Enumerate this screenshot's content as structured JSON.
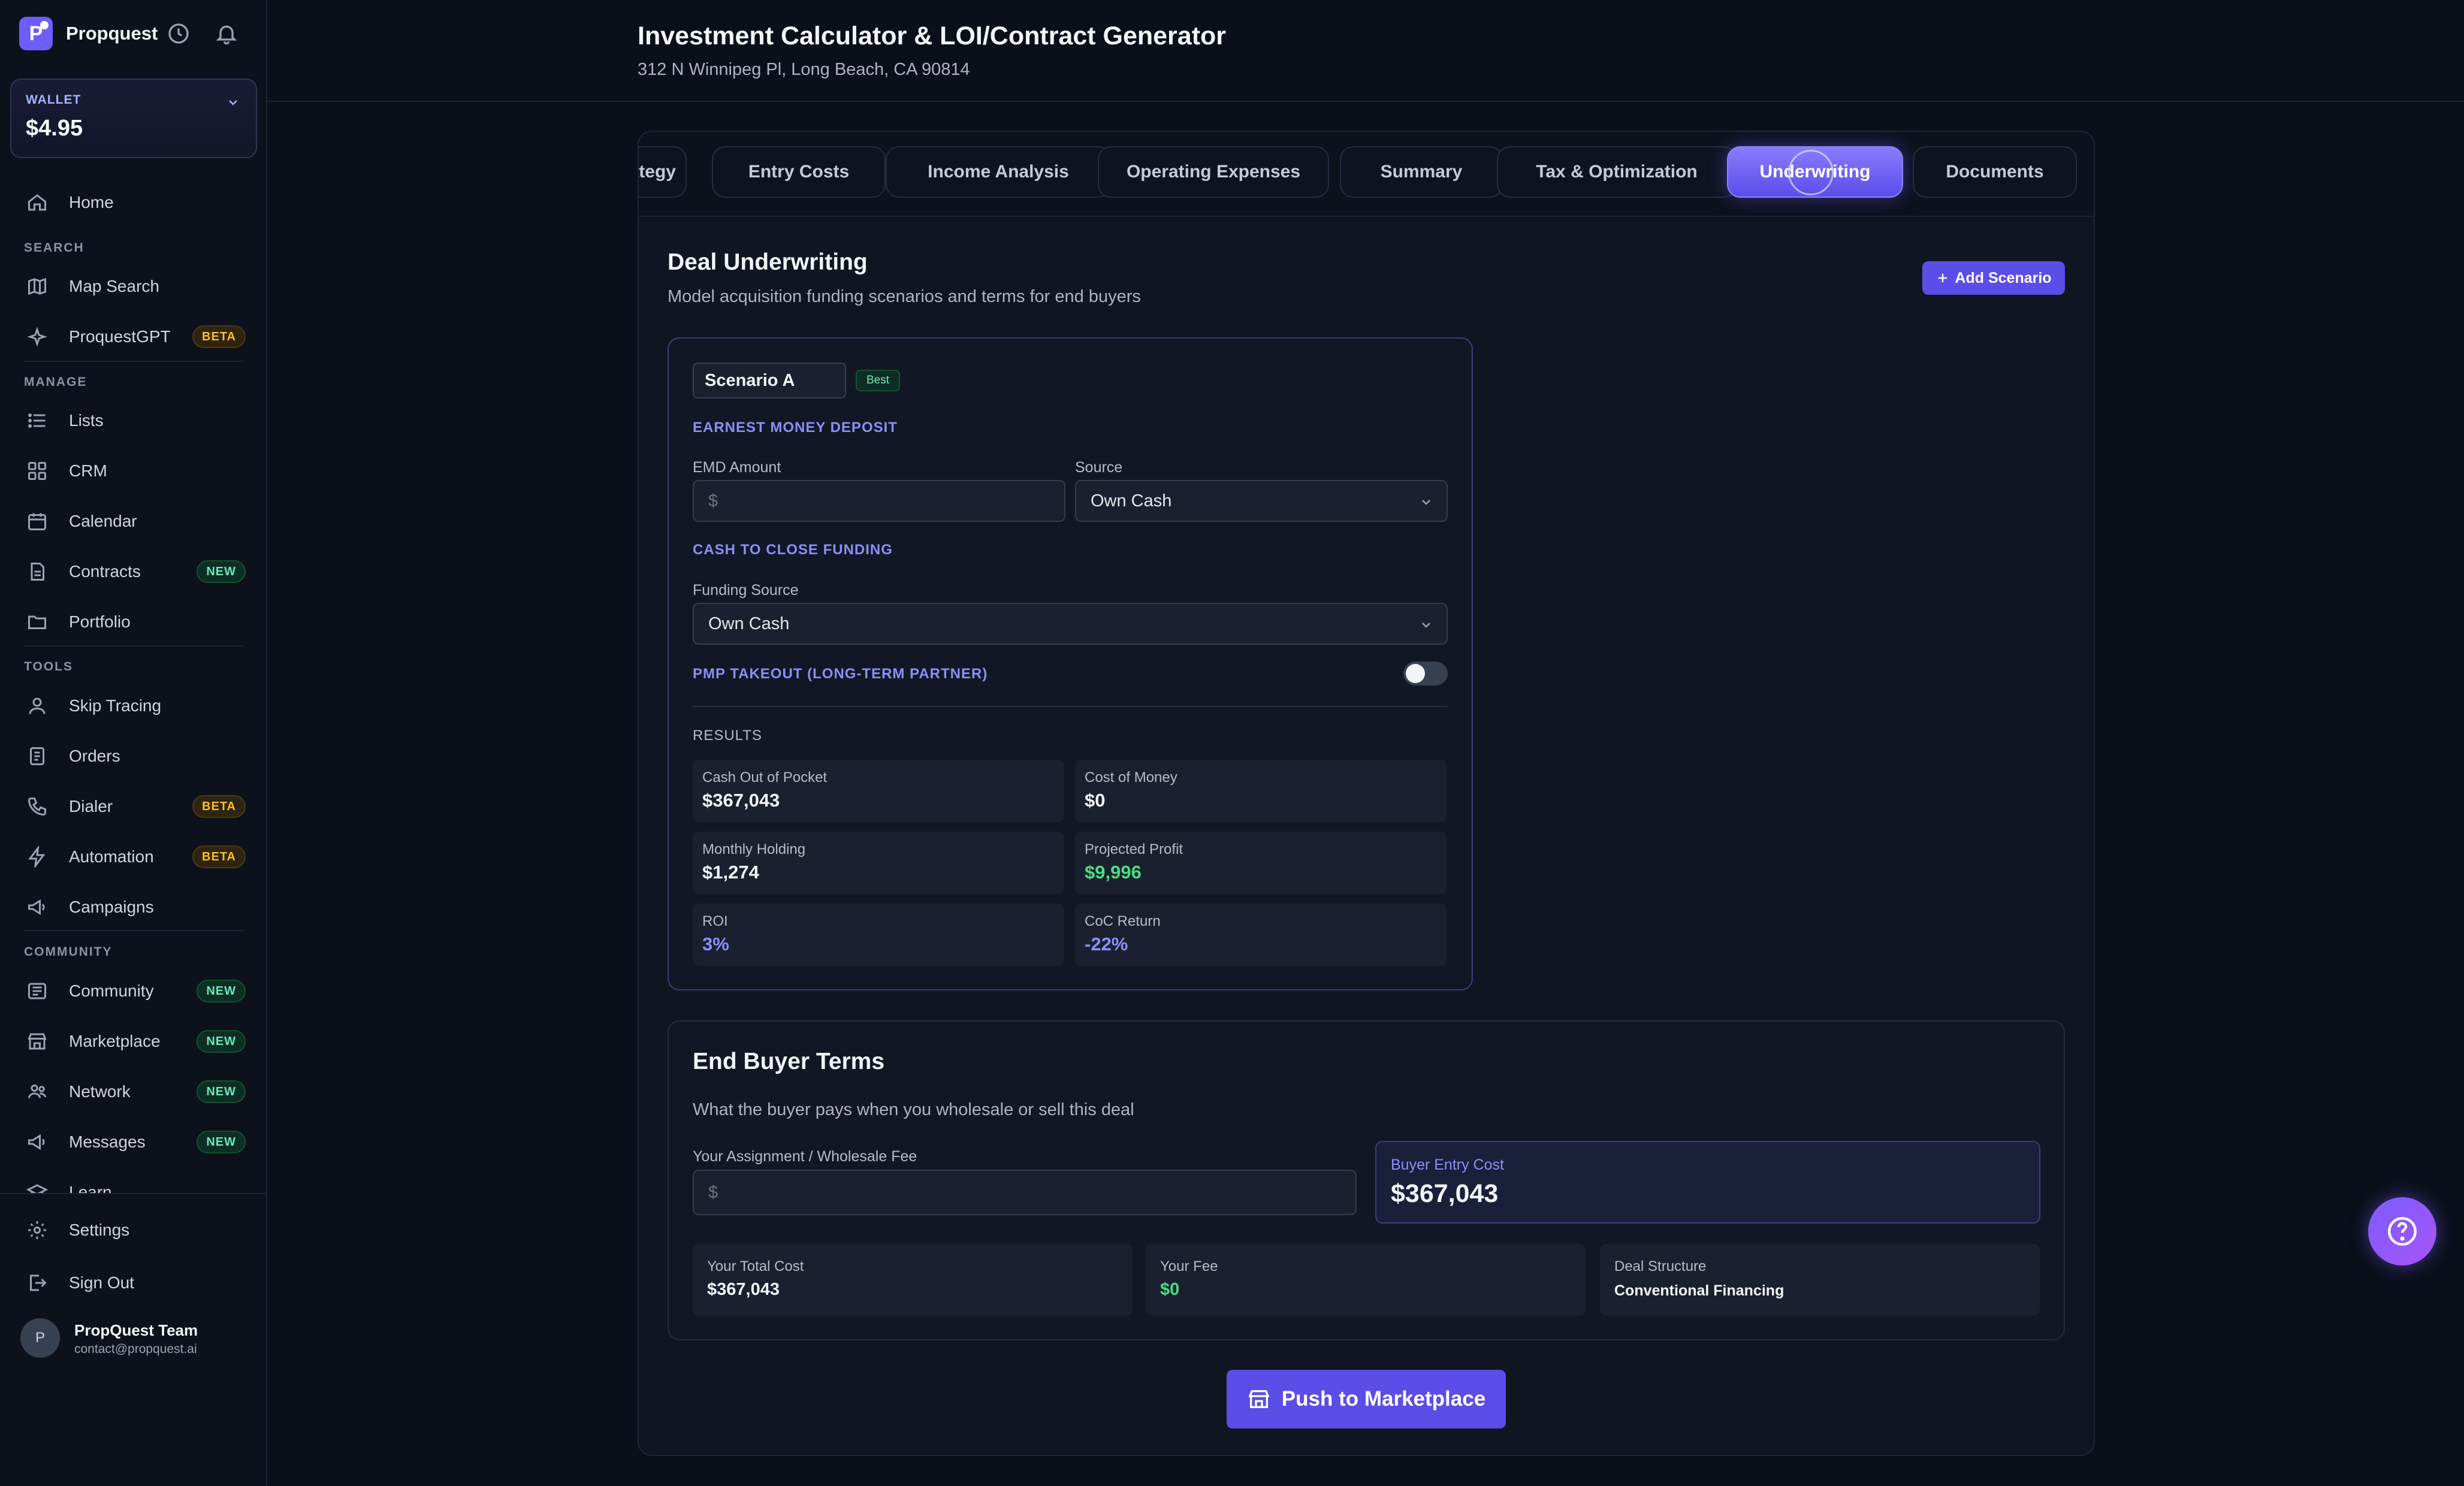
{
  "app": {
    "name": "Propquest",
    "logo_letter": "P"
  },
  "wallet": {
    "label": "WALLET",
    "balance": "$4.95"
  },
  "sidebar": {
    "home": "Home",
    "sections": {
      "search": "SEARCH",
      "manage": "MANAGE",
      "tools": "TOOLS",
      "community": "COMMUNITY"
    },
    "items": [
      {
        "label": "Map Search"
      },
      {
        "label": "ProquestGPT",
        "badge": "BETA"
      },
      {
        "label": "Lists"
      },
      {
        "label": "CRM"
      },
      {
        "label": "Calendar"
      },
      {
        "label": "Contracts",
        "badge": "NEW"
      },
      {
        "label": "Portfolio"
      },
      {
        "label": "Skip Tracing"
      },
      {
        "label": "Orders"
      },
      {
        "label": "Dialer",
        "badge": "BETA"
      },
      {
        "label": "Automation",
        "badge": "BETA"
      },
      {
        "label": "Campaigns"
      },
      {
        "label": "Community",
        "badge": "NEW"
      },
      {
        "label": "Marketplace",
        "badge": "NEW"
      },
      {
        "label": "Network",
        "badge": "NEW"
      },
      {
        "label": "Messages",
        "badge": "NEW"
      },
      {
        "label": "Learn"
      }
    ],
    "settings": "Settings",
    "sign_out": "Sign Out",
    "user": {
      "initial": "P",
      "name": "PropQuest Team",
      "email": "contact@propquest.ai"
    }
  },
  "header": {
    "title": "Investment Calculator & LOI/Contract Generator",
    "address": "312 N Winnipeg Pl, Long Beach, CA 90814"
  },
  "tabs": [
    {
      "label": "ategy"
    },
    {
      "label": "Entry Costs"
    },
    {
      "label": "Income Analysis"
    },
    {
      "label": "Operating Expenses"
    },
    {
      "label": "Summary"
    },
    {
      "label": "Tax & Optimization"
    },
    {
      "label": "Underwriting",
      "active": true
    },
    {
      "label": "Documents"
    }
  ],
  "underwriting": {
    "title": "Deal Underwriting",
    "description": "Model acquisition funding scenarios and terms for end buyers",
    "add_button": "Add Scenario",
    "scenario": {
      "name": "Scenario A",
      "badge": "Best",
      "emd_heading": "EARNEST MONEY DEPOSIT",
      "emd_amount_label": "EMD Amount",
      "emd_amount_placeholder": "$",
      "source_label": "Source",
      "source_value": "Own Cash",
      "ctc_heading": "CASH TO CLOSE FUNDING",
      "funding_source_label": "Funding Source",
      "funding_source_value": "Own Cash",
      "pmp_heading": "PMP TAKEOUT (LONG-TERM PARTNER)",
      "pmp_enabled": false,
      "results_label": "RESULTS",
      "results": [
        {
          "label": "Cash Out of Pocket",
          "value": "$367,043"
        },
        {
          "label": "Cost of Money",
          "value": "$0"
        },
        {
          "label": "Monthly Holding",
          "value": "$1,274"
        },
        {
          "label": "Projected Profit",
          "value": "$9,996"
        },
        {
          "label": "ROI",
          "value": "3%"
        },
        {
          "label": "CoC Return",
          "value": "-22%"
        }
      ]
    }
  },
  "end_buyer": {
    "title": "End Buyer Terms",
    "description": "What the buyer pays when you wholesale or sell this deal",
    "fee_label": "Your Assignment / Wholesale Fee",
    "fee_placeholder": "$",
    "entry_cost_label": "Buyer Entry Cost",
    "entry_cost_value": "$367,043",
    "total_cost_label": "Your Total Cost",
    "total_cost_value": "$367,043",
    "your_fee_label": "Your Fee",
    "your_fee_value": "$0",
    "structure_label": "Deal Structure",
    "structure_value": "Conventional Financing"
  },
  "push_button": "Push to Marketplace",
  "colors": {
    "accent": "#5b4de8",
    "positive": "#4ade80",
    "indigo_text": "#8b8ff7",
    "background": "#0b0f1a"
  }
}
